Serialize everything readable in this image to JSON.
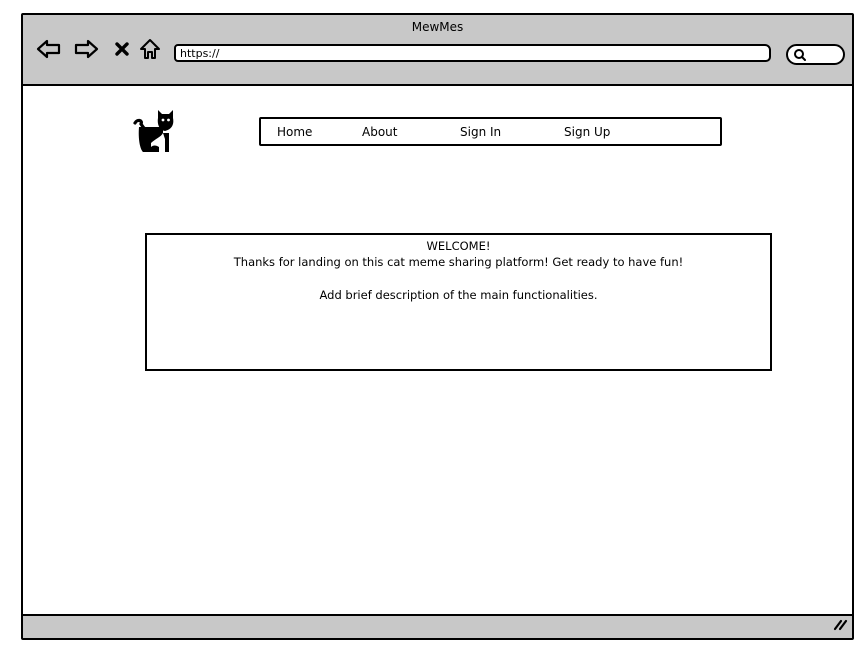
{
  "window": {
    "title": "MewMes"
  },
  "toolbar": {
    "back_icon": "back-arrow-icon",
    "forward_icon": "forward-arrow-icon",
    "stop_icon": "close-icon",
    "home_icon": "home-icon",
    "search_icon": "search-icon"
  },
  "address_bar": {
    "value": "https://"
  },
  "logo": {
    "icon": "cat-icon"
  },
  "nav": {
    "items": [
      {
        "label": "Home"
      },
      {
        "label": "About"
      },
      {
        "label": "Sign In"
      },
      {
        "label": "Sign Up"
      }
    ]
  },
  "welcome": {
    "heading": "WELCOME!",
    "tagline": "Thanks for landing on this cat meme sharing platform! Get ready to have fun!",
    "description": "Add brief description of the main functionalities."
  },
  "status_bar": {
    "grip_icon": "resize-grip-icon"
  },
  "colors": {
    "chrome": "#c8c8c8",
    "background": "#ffffff",
    "ink": "#000000"
  }
}
